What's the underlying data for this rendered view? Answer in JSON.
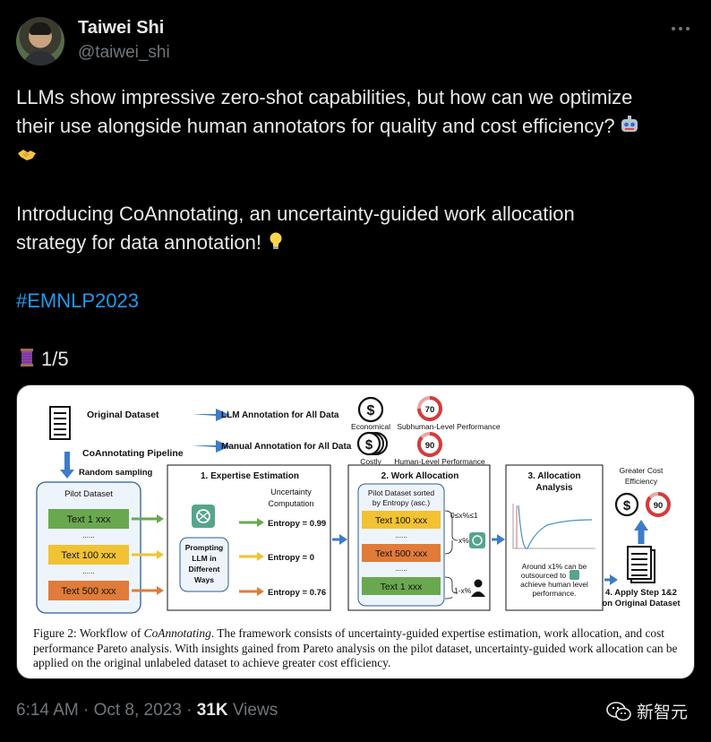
{
  "author": {
    "name": "Taiwei Shi",
    "handle": "@taiwei_shi"
  },
  "tweet": {
    "line1": "LLMs show impressive zero-shot capabilities, but how can we optimize",
    "line2": "their use alongside human annotators for quality and cost efficiency?",
    "line3": "Introducing CoAnnotating, an uncertainty-guided work allocation",
    "line4": "strategy for data annotation!",
    "hashtag": "#EMNLP2023",
    "thread": "1/5"
  },
  "figure": {
    "original_dataset": "Original Dataset",
    "llm_annotation": "LLM Annotation for All Data",
    "manual_annotation": "Manual Annotation for All Data",
    "pipeline": "CoAnnotating Pipeline",
    "random_sampling": "Random sampling",
    "economical": "Economical",
    "costly": "Costly",
    "subhuman": "Subhuman-Level Performance",
    "humanlevel": "Human-Level Performance",
    "score_low": "70",
    "score_high": "90",
    "pilot_dataset": "Pilot Dataset",
    "text1": "Text 1 xxx",
    "text100": "Text 100 xxx",
    "text500": "Text 500 xxx",
    "dots": "......",
    "expertise_title": "1. Expertise Estimation",
    "uncertainty": "Uncertainty",
    "computation": "Computation",
    "prompting1": "Prompting",
    "prompting2": "LLM in",
    "prompting3": "Different",
    "prompting4": "Ways",
    "entropy1": "Entropy = 0.99",
    "entropy2": "Entropy = 0",
    "entropy3": "Entropy = 0.76",
    "work_title": "2. Work Allocation",
    "sorted1": "Pilot Dataset sorted",
    "sorted2": "by Entropy (asc.)",
    "range": "0≤x%≤1",
    "xpct": "x%",
    "onexpct": "1-x%",
    "alloc_title1": "3. Allocation",
    "alloc_title2": "Analysis",
    "around1": "Around x1% can be",
    "around2": "outsourced to",
    "around3": "achieve human level",
    "around4": "performance.",
    "greater1": "Greater Cost",
    "greater2": "Efficiency",
    "apply1": "4. Apply Step 1&2",
    "apply2": "on Original Dataset",
    "dollar": "$",
    "caption_fig": "Figure 2:",
    "caption_wo": " Workflow of ",
    "caption_name": "CoAnnotating",
    "caption_rest": ". The framework consists of uncertainty-guided expertise estimation, work allocation, and cost performance Pareto analysis. With insights gained from Pareto analysis on the pilot dataset, uncertainty-guided work allocation can be applied on the original unlabeled dataset to achieve greater cost efficiency."
  },
  "meta": {
    "time": "6:14 AM · Oct 8, 2023 · ",
    "views_count": "31K",
    "views_label": " Views"
  },
  "watermark": "新智元",
  "colors": {
    "green": "#6aa84f",
    "yellow": "#f1c232",
    "orange": "#e07b39",
    "arrow_blue": "#3d7cc9",
    "hashtag": "#1d9bf0"
  }
}
